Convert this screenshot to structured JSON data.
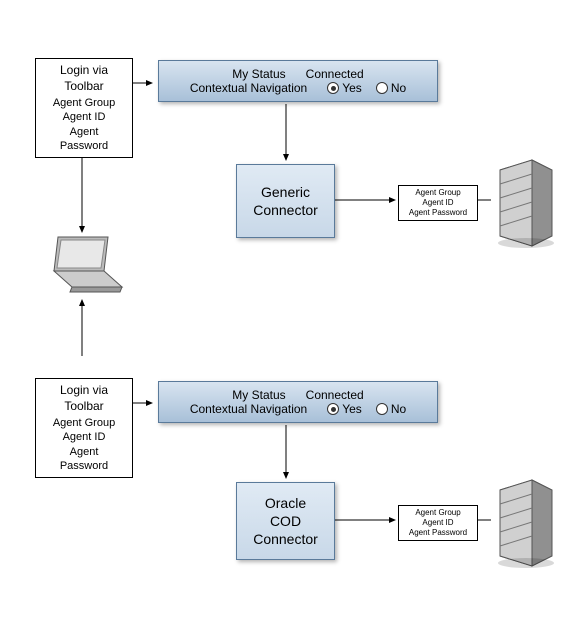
{
  "login1": {
    "title": "Login via Toolbar",
    "f1": "Agent Group",
    "f2": "Agent ID",
    "f3": "Agent Password"
  },
  "login2": {
    "title": "Login via Toolbar",
    "f1": "Agent Group",
    "f2": "Agent ID",
    "f3": "Agent Password"
  },
  "status": {
    "label1": "My Status",
    "label2": "Connected",
    "label3": "Contextual Navigation",
    "yes": "Yes",
    "no": "No"
  },
  "connector1": {
    "l1": "Generic",
    "l2": "Connector"
  },
  "connector2": {
    "l1": "Oracle",
    "l2": "COD",
    "l3": "Connector"
  },
  "cred": {
    "f1": "Agent Group",
    "f2": "Agent ID",
    "f3": "Agent Password"
  }
}
